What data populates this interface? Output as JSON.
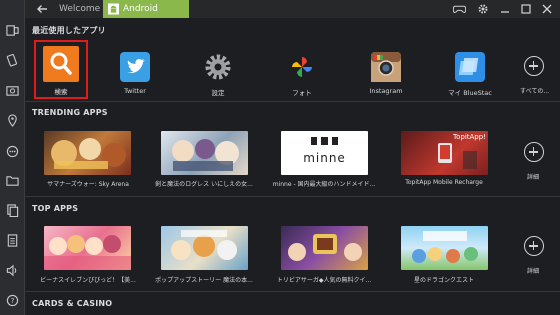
{
  "titlebar": {
    "back_icon": "back-arrow-icon",
    "tabs": [
      {
        "label": "Welcome"
      },
      {
        "label": "Android"
      }
    ],
    "right_icons": [
      "gamepad-icon",
      "gear-icon",
      "minimize-icon",
      "maximize-icon",
      "close-icon"
    ]
  },
  "sidebar": {
    "icons": [
      "multi-window-icon",
      "rotate-icon",
      "screenshot-icon",
      "location-icon",
      "chat-icon",
      "folder-icon",
      "copy-icon",
      "document-icon",
      "volume-icon",
      "help-icon"
    ]
  },
  "recent": {
    "title": "最近使用したアプリ",
    "apps": [
      {
        "label": "検索",
        "icon": "search-icon",
        "color": "#f07a1e"
      },
      {
        "label": "Twitter",
        "icon": "twitter-bird-icon",
        "color": "#3a9fe4"
      },
      {
        "label": "設定",
        "icon": "gear-icon",
        "color": "#9a9a9a"
      },
      {
        "label": "フォト",
        "icon": "pinwheel-icon",
        "color": "#ea4335"
      },
      {
        "label": "Instagram",
        "icon": "camera-icon",
        "color": "#8a5a3c"
      },
      {
        "label": "マイ BlueStac",
        "icon": "bluestacks-icon",
        "color": "#2f8fe6"
      }
    ],
    "more_label": "すべての..."
  },
  "trending": {
    "title": "TRENDING APPS",
    "apps": [
      {
        "label": "サマナーズウォー: Sky Arena"
      },
      {
        "label": "剣と魔法のログレス いにしえの女..."
      },
      {
        "label": "minne - 国内最大級のハンドメイド..."
      },
      {
        "label": "TopitApp Mobile Recharge"
      }
    ],
    "thumb_texts": {
      "minne": "minne",
      "topit": "TopitApp!"
    },
    "more_label": "詳細"
  },
  "top": {
    "title": "TOP APPS",
    "apps": [
      {
        "label": "ビーナスイレブンびびっど！【美..."
      },
      {
        "label": "ポップアップストーリー 魔法の本..."
      },
      {
        "label": "トリビアサーガ◆人気の無料クイ..."
      },
      {
        "label": "星のドラゴンクエスト"
      }
    ],
    "more_label": "詳細"
  },
  "cards": {
    "title": "CARDS & CASINO"
  }
}
